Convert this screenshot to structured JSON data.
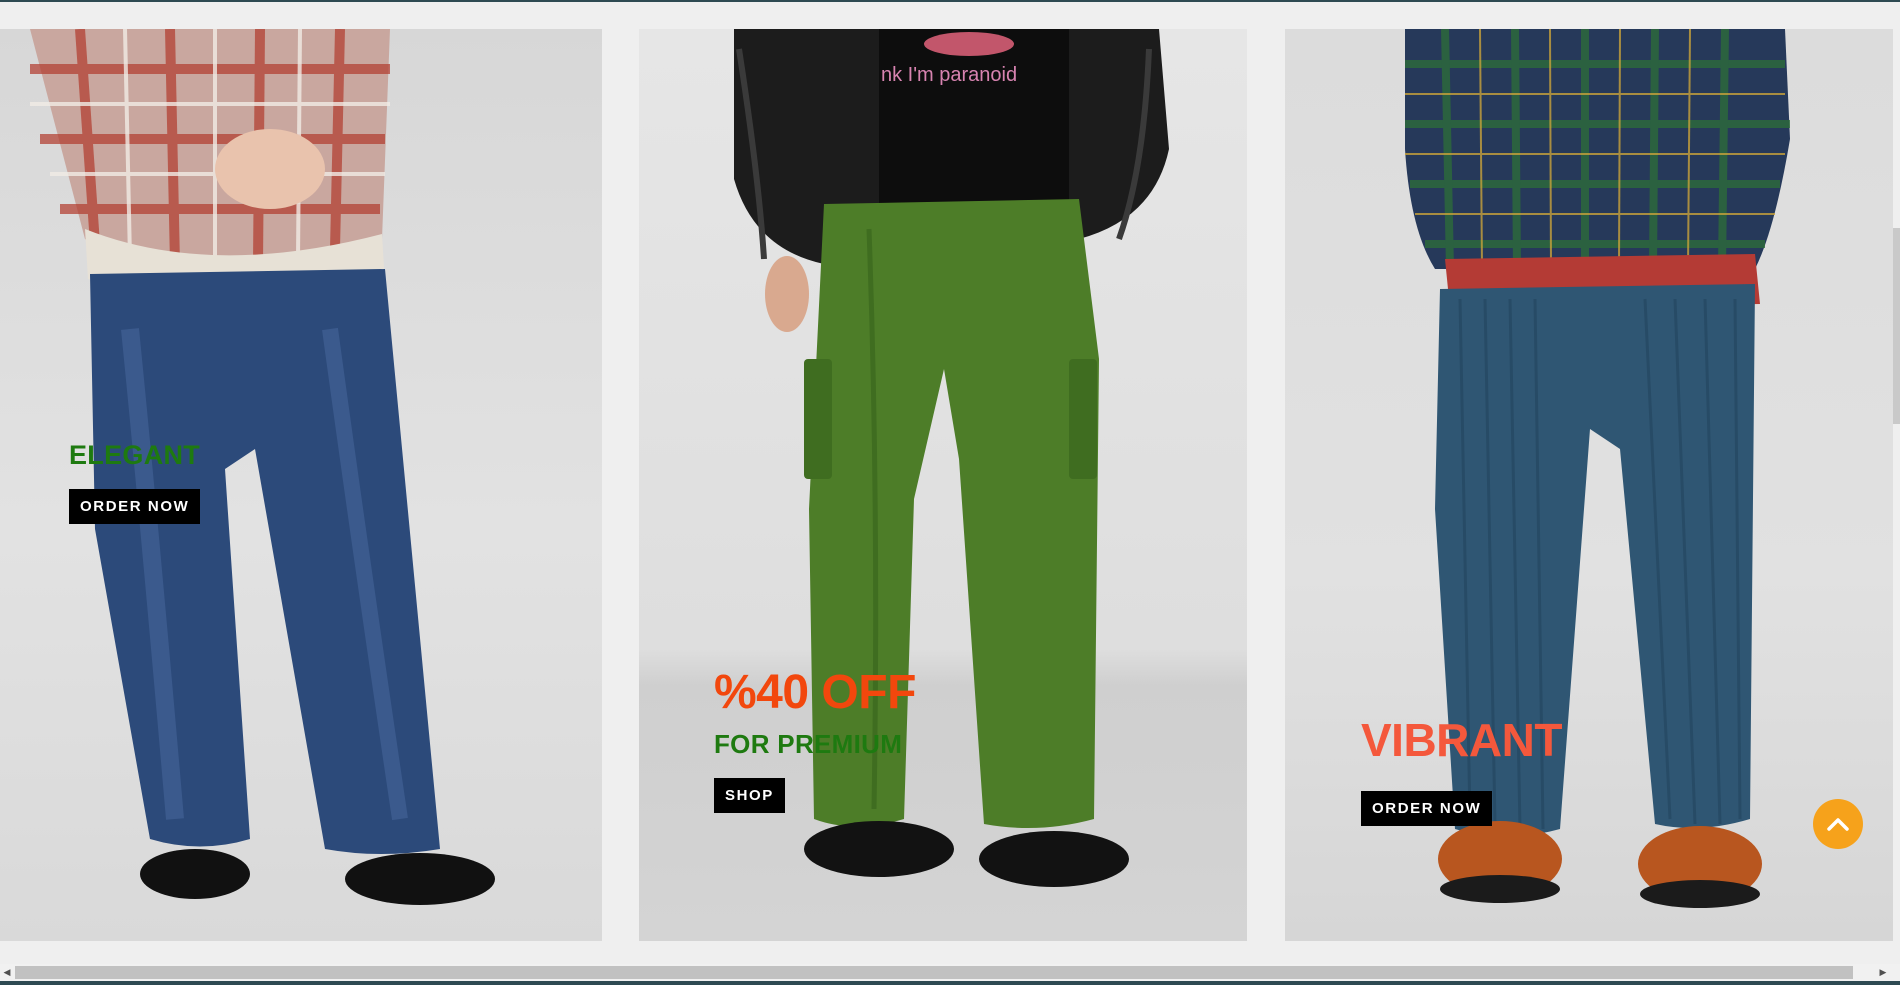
{
  "banners": [
    {
      "heading": "ELEGANT",
      "button": "ORDER NOW"
    },
    {
      "heading": "%40 OFF",
      "subheading": "FOR PREMIUM",
      "button": "SHOP"
    },
    {
      "heading": "VIBRANT",
      "button": "ORDER NOW"
    }
  ],
  "shirt_print": "nk I'm paranoid",
  "colors": {
    "heading_green": "#1e7a10",
    "heading_orange": "#f2470d",
    "heading_coral": "#f4583c",
    "button_bg": "#000000",
    "back_to_top": "#f6a21b"
  },
  "icons": {
    "back_to_top": "chevron-up-icon",
    "scroll_left": "triangle-left-icon",
    "scroll_right": "triangle-right-icon"
  }
}
